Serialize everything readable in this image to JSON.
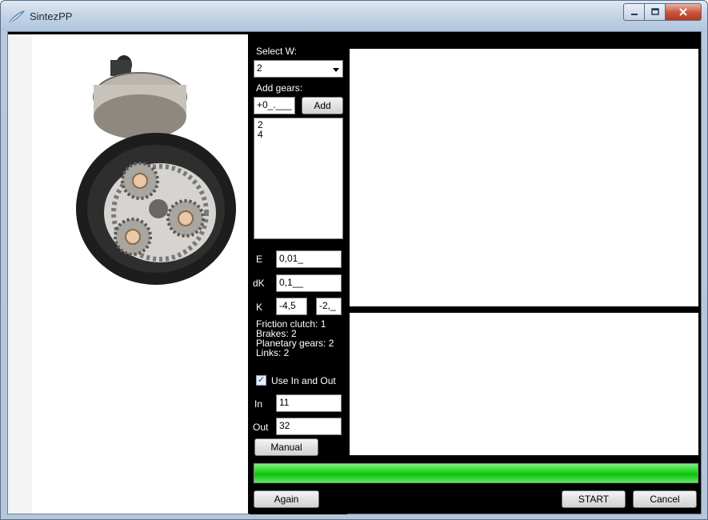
{
  "window": {
    "title": "SintezPP"
  },
  "icons": {
    "app": "feather-app-icon",
    "minimize": "minimize-icon",
    "maximize": "maximize-icon",
    "close": "close-icon"
  },
  "controls": {
    "select_w_label": "Select W:",
    "select_w_value": "2",
    "add_gears_label": "Add gears:",
    "add_gears_value": "+0_.___",
    "add_button": "Add",
    "gears_list": [
      "2",
      "4"
    ],
    "e_label": "E",
    "e_value": "0,01_",
    "dk_label": "dK",
    "dk_value": "0,1__",
    "k_label": "K",
    "k_min": "-4,5",
    "k_max": "-2,_",
    "info": {
      "friction_clutch": "Friction clutch: 1",
      "brakes": "Brakes: 2",
      "planetary_gears": "Planetary gears: 2",
      "links": "Links: 2"
    },
    "use_in_out_label": "Use In and Out",
    "use_in_out_checked": true,
    "in_label": "In",
    "in_value": "11",
    "out_label": "Out",
    "out_value": "32",
    "manual_button": "Manual"
  },
  "progress": {
    "value_percent": 100,
    "color": "#1bd11b"
  },
  "footer": {
    "again_button": "Again",
    "start_button": "START",
    "cancel_button": "Cancel"
  }
}
